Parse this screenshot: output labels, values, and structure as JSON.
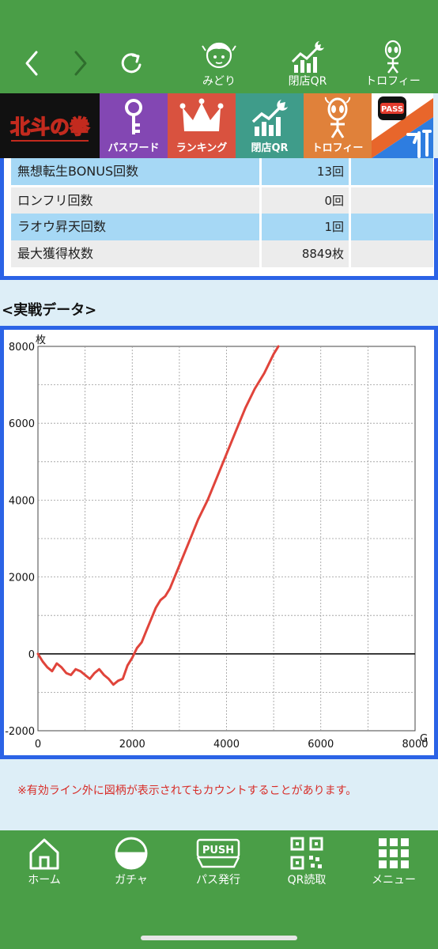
{
  "nav": {
    "items": [
      {
        "label": "みどり",
        "icon": "character-icon"
      },
      {
        "label": "閉店QR",
        "icon": "rising-chart-moon-icon"
      },
      {
        "label": "トロフィー",
        "icon": "alien-trophy-icon"
      }
    ]
  },
  "categories": {
    "logo_text": "北斗の拳",
    "items": [
      {
        "label": "パスワード",
        "icon": "key-icon"
      },
      {
        "label": "ランキング",
        "icon": "crown-icon"
      },
      {
        "label": "閉店QR",
        "icon": "rising-chart-moon-icon"
      },
      {
        "label": "トロフィー",
        "icon": "alien-trophy-icon"
      }
    ],
    "gachi_logo": "PASS"
  },
  "stats": {
    "rows": [
      {
        "label": "無想転生BONUS回数",
        "value": "13回"
      },
      {
        "label": "ロンフリ回数",
        "value": "0回"
      },
      {
        "label": "ラオウ昇天回数",
        "value": "1回"
      },
      {
        "label": "最大獲得枚数",
        "value": "8849枚"
      }
    ]
  },
  "section_title": "<実戦データ>",
  "chart_data": {
    "type": "line",
    "ylabel": "枚",
    "xlabel": "G",
    "xlim": [
      0,
      8000
    ],
    "ylim": [
      -2000,
      8000
    ],
    "x_ticks": [
      "0",
      "2000",
      "4000",
      "6000",
      "8000"
    ],
    "y_ticks": [
      "8000",
      "6000",
      "4000",
      "2000",
      "0",
      "-2000"
    ],
    "grid": true,
    "line_color": "#e0443b",
    "series": [
      {
        "x": [
          0,
          100,
          200,
          300,
          400,
          500,
          600,
          700,
          800,
          900,
          1000,
          1100,
          1200,
          1300,
          1400,
          1500,
          1600,
          1700,
          1800,
          1900,
          2000,
          2100,
          2200,
          2300,
          2400,
          2500,
          2600,
          2700,
          2800,
          2900,
          3000,
          3200,
          3400,
          3600,
          3800,
          4000,
          4200,
          4400,
          4600,
          4800,
          5000,
          5100
        ],
        "y": [
          0,
          -200,
          -350,
          -450,
          -250,
          -350,
          -500,
          -550,
          -400,
          -450,
          -550,
          -650,
          -500,
          -400,
          -550,
          -650,
          -800,
          -700,
          -650,
          -300,
          -100,
          150,
          300,
          600,
          900,
          1200,
          1400,
          1500,
          1700,
          2000,
          2300,
          2900,
          3500,
          4000,
          4600,
          5200,
          5800,
          6400,
          6900,
          7300,
          7800,
          8000
        ]
      }
    ]
  },
  "note": "※有効ライン外に図柄が表示されてもカウントすることがあります。",
  "bottom": {
    "items": [
      {
        "label": "ホーム",
        "icon": "home-icon"
      },
      {
        "label": "ガチャ",
        "icon": "gacha-ball-icon"
      },
      {
        "label": "パス発行",
        "icon": "push-button-icon",
        "badge": "PUSH"
      },
      {
        "label": "QR読取",
        "icon": "qr-code-icon"
      },
      {
        "label": "メニュー",
        "icon": "grid-menu-icon"
      }
    ]
  }
}
